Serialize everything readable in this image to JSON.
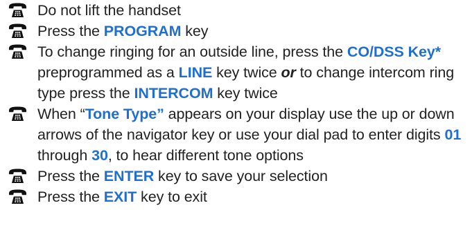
{
  "steps": [
    {
      "icon": "telephone-icon",
      "parts": [
        {
          "text": "Do not lift the handset",
          "style": "plain"
        }
      ]
    },
    {
      "icon": "telephone-icon",
      "parts": [
        {
          "text": "Press the ",
          "style": "plain"
        },
        {
          "text": "PROGRAM",
          "style": "keyword"
        },
        {
          "text": " key",
          "style": "plain"
        }
      ]
    },
    {
      "icon": "telephone-icon",
      "parts": [
        {
          "text": "To change ringing for an outside line, press the ",
          "style": "plain"
        },
        {
          "text": "CO/DSS",
          "style": "keyword"
        },
        {
          "text": " ",
          "style": "plain"
        },
        {
          "text": "Key*",
          "style": "keyword"
        },
        {
          "text": " preprogrammed as a ",
          "style": "plain"
        },
        {
          "text": "LINE",
          "style": "keyword"
        },
        {
          "text": " key twice ",
          "style": "plain"
        },
        {
          "text": "or",
          "style": "emphasis"
        },
        {
          "text": " to change intercom ring type press the ",
          "style": "plain"
        },
        {
          "text": "INTERCOM",
          "style": "keyword"
        },
        {
          "text": " key twice",
          "style": "plain"
        }
      ]
    },
    {
      "icon": "telephone-icon",
      "parts": [
        {
          "text": "When “",
          "style": "plain"
        },
        {
          "text": "Tone Type”",
          "style": "keyword"
        },
        {
          "text": " appears on your display use the up or down arrows of the navigator key or use your dial pad to enter digits ",
          "style": "plain"
        },
        {
          "text": "01",
          "style": "keyword"
        },
        {
          "text": " through ",
          "style": "plain"
        },
        {
          "text": "30",
          "style": "keyword"
        },
        {
          "text": ", to hear different tone options",
          "style": "plain"
        }
      ]
    },
    {
      "icon": "telephone-icon",
      "parts": [
        {
          "text": "Press the ",
          "style": "plain"
        },
        {
          "text": "ENTER",
          "style": "keyword"
        },
        {
          "text": " key to save your selection",
          "style": "plain"
        }
      ]
    },
    {
      "icon": "telephone-icon",
      "parts": [
        {
          "text": "Press the ",
          "style": "plain"
        },
        {
          "text": "EXIT",
          "style": "keyword"
        },
        {
          "text": " key to exit",
          "style": "plain"
        }
      ]
    }
  ],
  "colors": {
    "keyword": "#1f6fd1",
    "text": "#222222",
    "icon": "#111111"
  }
}
